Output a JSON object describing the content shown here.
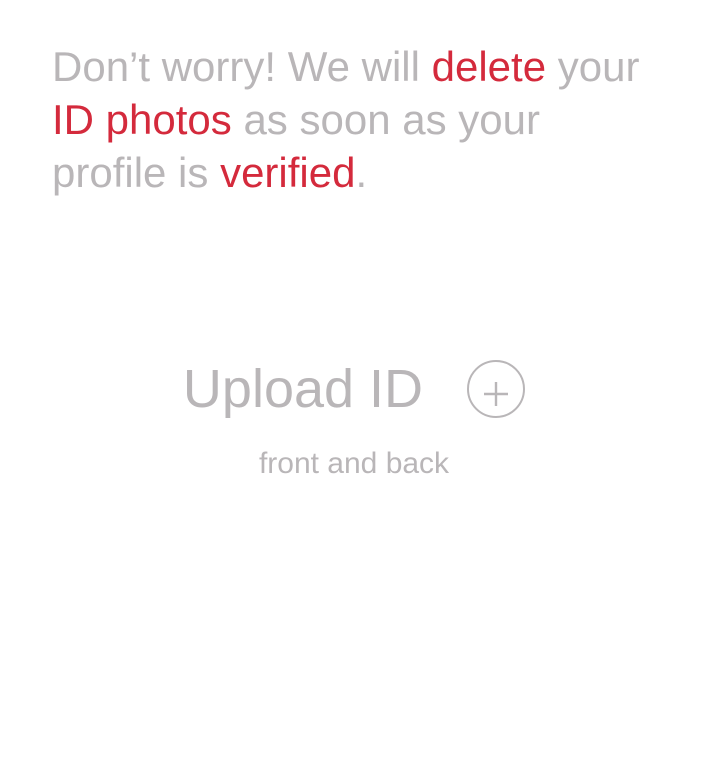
{
  "notice": {
    "part1": "Don’t worry! We will ",
    "highlight1": "delete",
    "part2": " your ",
    "highlight2": "ID photos",
    "part3": " as soon as your profile is ",
    "highlight3": "verified",
    "part4": "."
  },
  "upload": {
    "label": "Upload ID",
    "icon": "plus-circle-icon",
    "subtitle": "front and back"
  },
  "colors": {
    "text": "#b9b6b8",
    "accent": "#d42a3c",
    "background": "#ffffff"
  }
}
